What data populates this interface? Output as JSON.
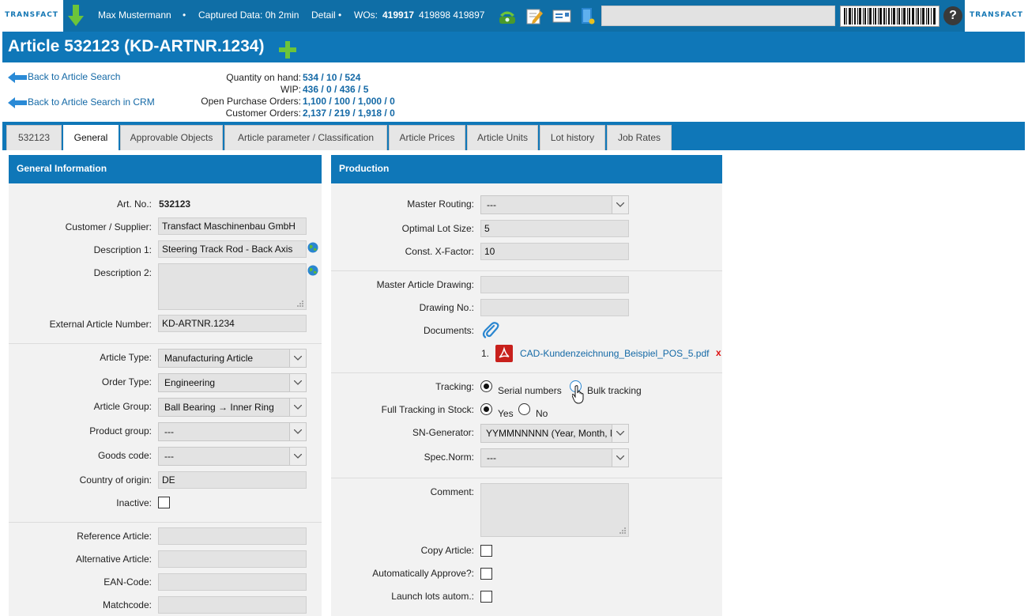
{
  "topbar": {
    "logo_text": "TRANSFACT",
    "user": "Max Mustermann",
    "bullet": "•",
    "captured": "Captured Data: 0h 2min",
    "detail": "Detail •",
    "wos_label": "WOs:",
    "wo_active": "419917",
    "wo_others": "419898 419897",
    "search_value": ""
  },
  "title": {
    "text": "Article 532123 (KD-ARTNR.1234)"
  },
  "links": {
    "back_article_search": "Back to Article Search",
    "back_article_search_crm": "Back to Article Search in CRM"
  },
  "quantities": [
    {
      "label": "Quantity on hand:",
      "value": "534 / 10 / 524"
    },
    {
      "label": "WIP:",
      "value": "436 / 0 / 436 / 5"
    },
    {
      "label": "Open Purchase Orders:",
      "value": "1,100 / 100 / 1,000 / 0"
    },
    {
      "label": "Customer Orders:",
      "value": "2,137 / 219 / 1,918 / 0"
    }
  ],
  "tabs": [
    "532123",
    "General",
    "Approvable Objects",
    "Article parameter / Classification",
    "Article Prices",
    "Article Units",
    "Lot history",
    "Job Rates"
  ],
  "active_tab": "General",
  "general": {
    "header": "General Information",
    "art_no_label": "Art. No.:",
    "art_no": "532123",
    "customer_label": "Customer / Supplier:",
    "customer": "Transfact Maschinenbau GmbH",
    "desc1_label": "Description 1:",
    "desc1": "Steering Track Rod - Back Axis",
    "desc2_label": "Description 2:",
    "desc2": "",
    "ext_label": "External Article Number:",
    "ext": "KD-ARTNR.1234",
    "type_label": "Article Type:",
    "type": "Manufacturing Article",
    "order_label": "Order Type:",
    "order": "Engineering",
    "group_label": "Article Group:",
    "group": "Ball Bearing → Inner Ring",
    "product_label": "Product group:",
    "product": "---",
    "goods_label": "Goods code:",
    "goods": "---",
    "country_label": "Country of origin:",
    "country": "DE",
    "inactive_label": "Inactive:",
    "reference_label": "Reference Article:",
    "alternative_label": "Alternative Article:",
    "ean_label": "EAN-Code:",
    "matchcode_label": "Matchcode:"
  },
  "production": {
    "header": "Production",
    "routing_label": "Master Routing:",
    "routing": "---",
    "lot_label": "Optimal Lot Size:",
    "lot": "5",
    "xfactor_label": "Const. X-Factor:",
    "xfactor": "10",
    "drawing_master_label": "Master Article Drawing:",
    "drawing_no_label": "Drawing No.:",
    "documents_label": "Documents:",
    "doc_index": "1.",
    "doc_name": "CAD-Kundenzeichnung_Beispiel_POS_5.pdf",
    "doc_delete": "x",
    "tracking_label": "Tracking:",
    "tracking_serial": "Serial numbers",
    "tracking_bulk": "Bulk tracking",
    "full_tracking_label": "Full Tracking in Stock:",
    "yes": "Yes",
    "no": "No",
    "sn_label": "SN-Generator:",
    "sn": "YYMMNNNNN (Year, Month, N",
    "spec_label": "Spec.Norm:",
    "spec": "---",
    "comment_label": "Comment:",
    "copy_label": "Copy Article:",
    "approve_label": "Automatically Approve?:",
    "launch_label": "Launch lots autom.:"
  },
  "colors": {
    "accent": "#0f77b8",
    "link": "#1469a6",
    "field": "#e3e3e3",
    "panel": "#f2f2f2"
  }
}
